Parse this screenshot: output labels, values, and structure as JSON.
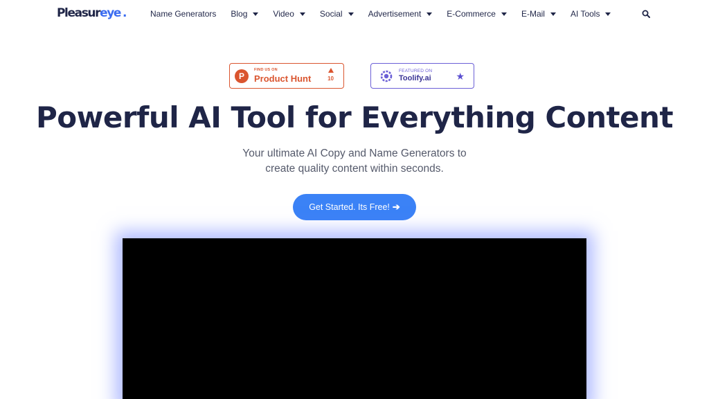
{
  "brand": {
    "name_main": "Pleasur",
    "name_accent": "eye",
    "name_dot": ".",
    "accent_color": "#3b6cf0"
  },
  "nav": {
    "items": [
      {
        "label": "Name Generators",
        "has_dropdown": false
      },
      {
        "label": "Blog",
        "has_dropdown": true
      },
      {
        "label": "Video",
        "has_dropdown": true
      },
      {
        "label": "Social",
        "has_dropdown": true
      },
      {
        "label": "Advertisement",
        "has_dropdown": true
      },
      {
        "label": "E-Commerce",
        "has_dropdown": true
      },
      {
        "label": "E-Mail",
        "has_dropdown": true
      },
      {
        "label": "AI Tools",
        "has_dropdown": true
      }
    ],
    "search_icon": "search-icon"
  },
  "badges": {
    "product_hunt": {
      "small": "FIND US ON",
      "big": "Product Hunt",
      "logo_letter": "P",
      "votes": "10",
      "color": "#da552f"
    },
    "toolify": {
      "small": "FEATURED ON",
      "big": "Toolify.ai",
      "color": "#6b5fd6"
    }
  },
  "hero": {
    "title": "Powerful AI Tool for Everything Content",
    "subtitle_line1": "Your ultimate AI Copy and Name Generators to",
    "subtitle_line2": "create quality content within seconds.",
    "cta_label": "Get Started. Its Free!",
    "cta_color": "#3b82f6"
  }
}
